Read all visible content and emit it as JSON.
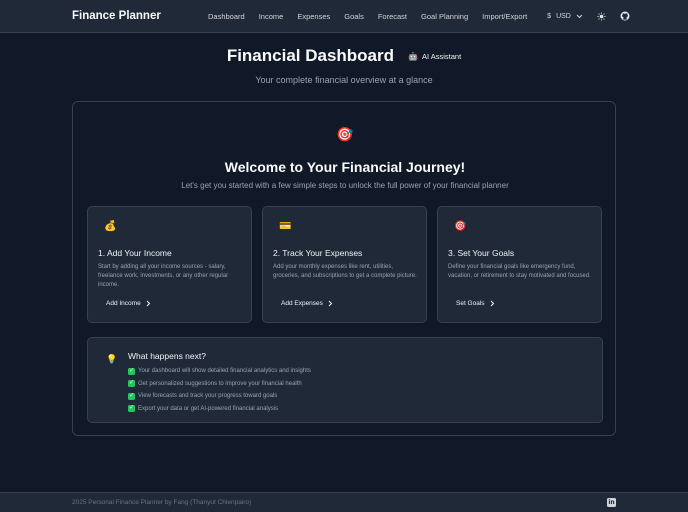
{
  "nav": {
    "brand": "Finance Planner",
    "links": [
      "Dashboard",
      "Income",
      "Expenses",
      "Goals",
      "Forecast",
      "Goal Planning",
      "Import/Export"
    ],
    "currency_symbol": "$",
    "currency_code": "USD"
  },
  "header": {
    "title": "Financial Dashboard",
    "ai_button": "AI Assistant",
    "subtitle": "Your complete financial overview at a glance"
  },
  "welcome": {
    "icon": "🎯",
    "title": "Welcome to Your Financial Journey!",
    "subtitle": "Let's get you started with a few simple steps to unlock the full power of your financial planner"
  },
  "steps": [
    {
      "icon": "💰",
      "title": "1. Add Your Income",
      "description": "Start by adding all your income sources - salary, freelance work, investments, or any other regular income.",
      "link": "Add Income"
    },
    {
      "icon": "💳",
      "title": "2. Track Your Expenses",
      "description": "Add your monthly expenses like rent, utilities, groceries, and subscriptions to get a complete picture.",
      "link": "Add Expenses"
    },
    {
      "icon": "🎯",
      "title": "3. Set Your Goals",
      "description": "Define your financial goals like emergency fund, vacation, or retirement to stay motivated and focused.",
      "link": "Set Goals"
    }
  ],
  "next": {
    "icon": "💡",
    "title": "What happens next?",
    "items": [
      "Your dashboard will show detailed financial analytics and insights",
      "Get personalized suggestions to improve your financial health",
      "View forecasts and track your progress toward goals",
      "Export your data or get AI-powered financial analysis"
    ]
  },
  "footer": {
    "copyright": "2025 Personal Finance Planner by Fang (Thanyut Chienpairo)"
  }
}
